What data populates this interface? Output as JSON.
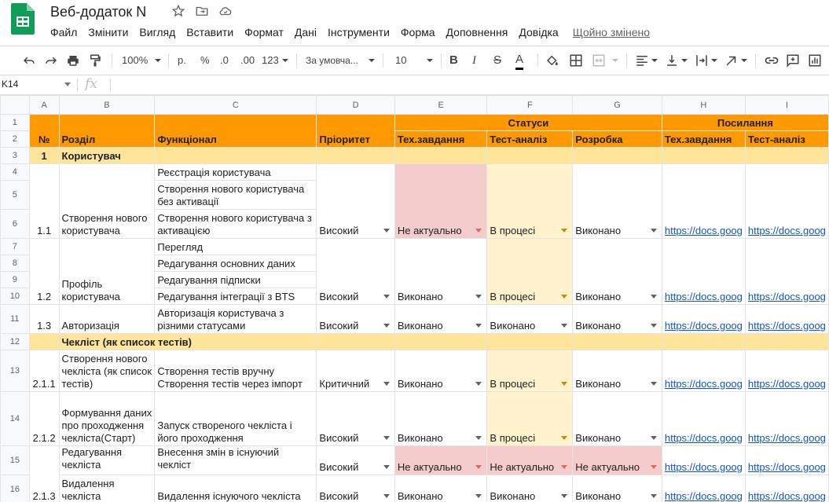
{
  "app": {
    "title": "Веб-додаток N",
    "saved_status": "Щойно змінено",
    "accent_color": "#0f9d58"
  },
  "menu": [
    "Файл",
    "Змінити",
    "Вигляд",
    "Вставити",
    "Формат",
    "Дані",
    "Інструменти",
    "Форма",
    "Доповнення",
    "Довідка"
  ],
  "toolbar": {
    "zoom": "100%",
    "currency": "р.",
    "percent": "%",
    "dec_less": ".0",
    "dec_more": ".00",
    "more_formats": "123",
    "font": "За умовча...",
    "font_size": "10",
    "bold": "B",
    "italic": "I",
    "strike": "S",
    "text_color": "A"
  },
  "formula_bar": {
    "cell": "K14",
    "fx": "fx"
  },
  "columns": [
    "A",
    "B",
    "C",
    "D",
    "E",
    "F",
    "G",
    "H",
    "I"
  ],
  "header": {
    "num": "№",
    "section": "Розділ",
    "functional": "Функціонал",
    "priority": "Пріоритет",
    "statuses": "Статуси",
    "links": "Посилання",
    "tech": "Тех.завдання",
    "test": "Тест-аналіз",
    "dev": "Розробка",
    "link_tech": "Тех.завдання",
    "link_test": "Тест-аналіз"
  },
  "rows": {
    "r3": {
      "num": "1",
      "section": "Користувач"
    },
    "r4": {
      "func": "Реєстрація користувача"
    },
    "r5": {
      "func": "Створення нового користувача без активації"
    },
    "r6": {
      "num": "1.1",
      "section": "Створення нового користувача",
      "func": "Створення нового користувача з активацією",
      "priority": "Високий",
      "tech": "Не актуально",
      "test": "В процесі",
      "dev": "Виконано",
      "link1": "https://docs.goog",
      "link2": "https://docs.goog"
    },
    "r7": {
      "func": "Перегляд"
    },
    "r8": {
      "func": "Редагування основних даних"
    },
    "r9": {
      "func": "Редагування підписки"
    },
    "r10": {
      "num": "1.2",
      "section": "Профіль користувача",
      "func": "Редагування інтеграції з BTS",
      "priority": "Високий",
      "tech": "Виконано",
      "test": "В процесі",
      "dev": "Виконано",
      "link1": "https://docs.goog",
      "link2": "https://docs.goog"
    },
    "r11": {
      "num": "1.3",
      "section": "Авторизація",
      "func": "Авторизація користувача з різними статусами",
      "priority": "Високий",
      "tech": "Виконано",
      "test": "Виконано",
      "dev": "Виконано",
      "link1": "https://docs.goog",
      "link2": "https://docs.goog"
    },
    "r12": {
      "section": "Чекліст (як список тестів)"
    },
    "r13": {
      "num": "2.1.1",
      "section": "Створення нового чекліста (як список тестів)",
      "func": "Створення тестів вручну Створення тестів через імпорт",
      "priority": "Критичний",
      "tech": "Виконано",
      "test": "В процесі",
      "dev": "Виконано",
      "link1": "https://docs.goog",
      "link2": "https://docs.goog"
    },
    "r14": {
      "num": "2.1.2",
      "section": "Формування даних про проходження чекліста(Старт)",
      "func": "Запуск створеного чекліста і його проходження",
      "priority": "Високий",
      "tech": "Виконано",
      "test": "В процесі",
      "dev": "Виконано",
      "link1": "https://docs.goog",
      "link2": "https://docs.goog"
    },
    "r15": {
      "section": "Редагування чекліста",
      "func": "Внесення змін в існуючий чекліст",
      "priority": "Високий",
      "tech": "Не актуально",
      "test": "Не актуально",
      "dev": "Не актуально",
      "link1": "https://docs.goog",
      "link2": "https://docs.goog"
    },
    "r16": {
      "num": "2.1.3",
      "section": "Видалення чекліста",
      "func": "Видалення існуючого чекліста",
      "priority": "Високий",
      "tech": "Виконано",
      "test": "Виконано",
      "dev": "Виконано",
      "link1": "https://docs.goog",
      "link2": "https://docs.goog"
    }
  }
}
